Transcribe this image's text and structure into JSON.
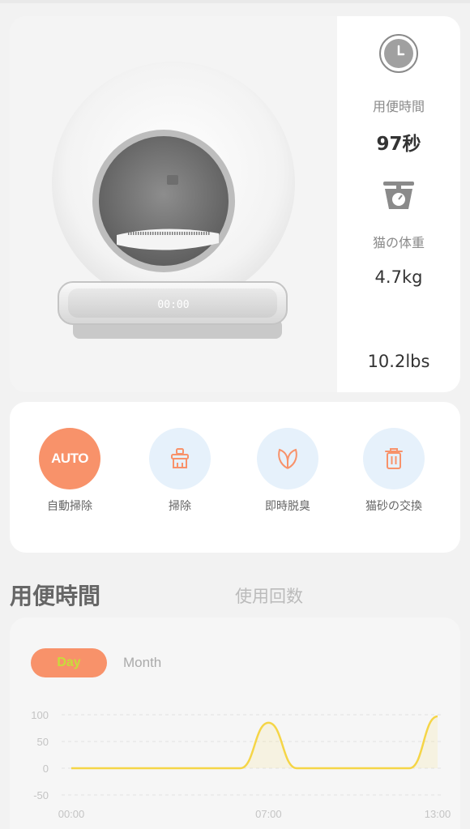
{
  "device": {
    "image_alt": "",
    "display_text": "00:00"
  },
  "stats": {
    "time_icon": "clock-icon",
    "time_label": "用便時間",
    "time_value": "97秒",
    "weight_icon": "scale-icon",
    "weight_label": "猫の体重",
    "weight_kg": "4.7kg",
    "weight_lbs": "10.2lbs"
  },
  "actions": [
    {
      "label": "自動掃除",
      "icon": "auto-text",
      "badge": "AUTO",
      "active": true
    },
    {
      "label": "掃除",
      "icon": "broom-icon",
      "active": false
    },
    {
      "label": "即時脱臭",
      "icon": "leaf-icon",
      "active": false
    },
    {
      "label": "猫砂の交換",
      "icon": "trash-icon",
      "active": false
    }
  ],
  "tabs": {
    "main": "用便時間",
    "secondary": "使用回数"
  },
  "segments": {
    "day": "Day",
    "month": "Month"
  },
  "colors": {
    "accent": "#f8926a",
    "line": "#f5d547",
    "action_bg": "#e6f1fb"
  },
  "chart_data": {
    "type": "line",
    "x": [
      "00:00",
      "01:00",
      "02:00",
      "03:00",
      "04:00",
      "05:00",
      "06:00",
      "07:00",
      "08:00",
      "09:00",
      "10:00",
      "11:00",
      "12:00",
      "13:00"
    ],
    "x_ticks": [
      "00:00",
      "07:00",
      "13:00"
    ],
    "y_ticks": [
      100,
      50,
      0,
      -50
    ],
    "ylim": [
      -50,
      100
    ],
    "series": [
      {
        "values": [
          0,
          0,
          0,
          0,
          0,
          0,
          0,
          85,
          0,
          0,
          0,
          0,
          0,
          97
        ]
      }
    ],
    "grid": true
  }
}
